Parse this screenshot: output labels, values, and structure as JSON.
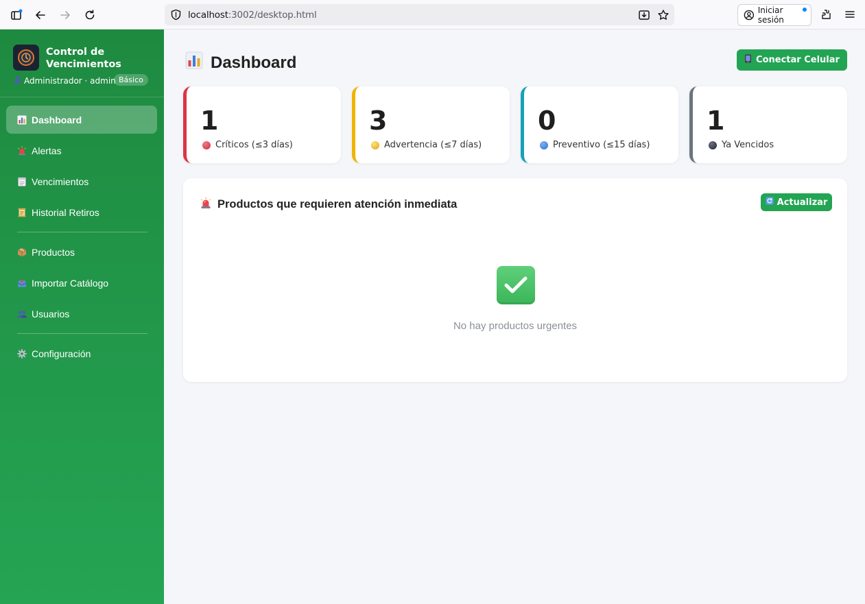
{
  "browser": {
    "url_host": "localhost",
    "url_path": ":3002/desktop.html",
    "signin_label": "Iniciar sesión"
  },
  "sidebar": {
    "app_title": "Control de Vencimientos",
    "user_line": "Administrador · admin",
    "plan_badge": "Básico",
    "items": [
      {
        "label": "Dashboard",
        "icon": "bar-chart-icon",
        "active": true
      },
      {
        "label": "Alertas",
        "icon": "siren-icon",
        "active": false
      },
      {
        "label": "Vencimientos",
        "icon": "calendar-icon",
        "active": false
      },
      {
        "label": "Historial Retiros",
        "icon": "scroll-icon",
        "active": false
      },
      {
        "label": "Productos",
        "icon": "package-icon",
        "active": false
      },
      {
        "label": "Importar Catálogo",
        "icon": "inbox-tray-icon",
        "active": false
      },
      {
        "label": "Usuarios",
        "icon": "users-icon",
        "active": false
      },
      {
        "label": "Configuración",
        "icon": "gear-icon",
        "active": false
      }
    ]
  },
  "header": {
    "title": "Dashboard",
    "connect_button": "Conectar Celular"
  },
  "stats": [
    {
      "value": "1",
      "label": "Críticos (≤3 días)",
      "color": "#dc3545"
    },
    {
      "value": "3",
      "label": "Advertencia (≤7 días)",
      "color": "#f0b400"
    },
    {
      "value": "0",
      "label": "Preventivo (≤15 días)",
      "color": "#17a2b8"
    },
    {
      "value": "1",
      "label": "Ya Vencidos",
      "color": "#6c757d"
    }
  ],
  "panel": {
    "title": "Productos que requieren atención inmediata",
    "refresh_button": "Actualizar",
    "empty_message": "No hay productos urgentes"
  },
  "colors": {
    "accent": "#22a453",
    "sidebar_top": "#1e8a40",
    "sidebar_bottom": "#25a454"
  }
}
